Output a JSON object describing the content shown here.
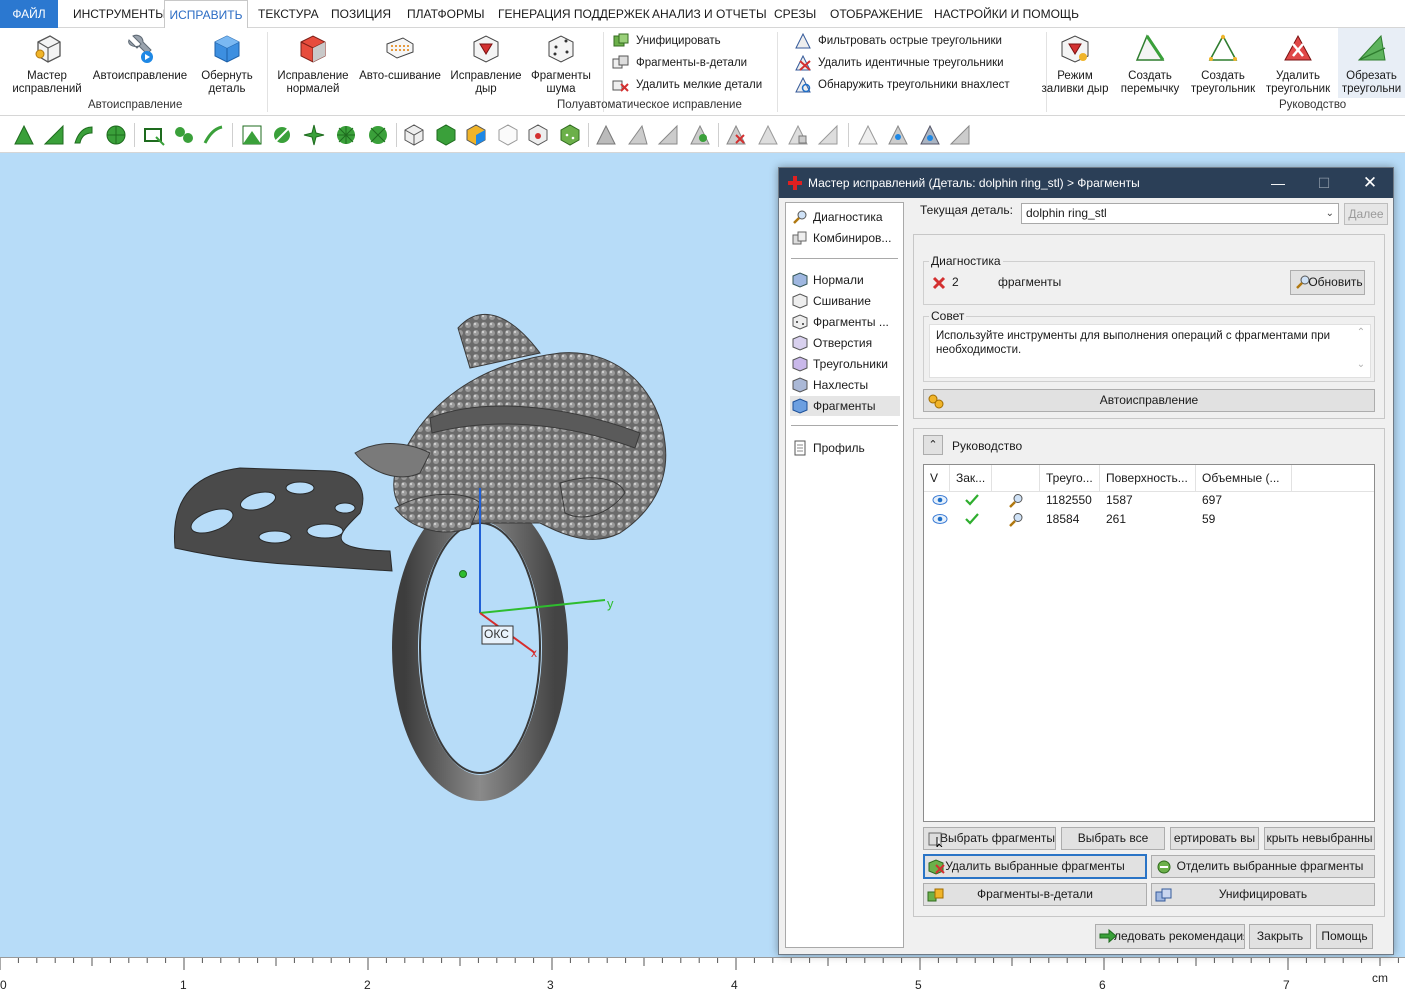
{
  "menu": {
    "file": "ФАЙЛ",
    "tools": "ИНСТРУМЕНТЫ",
    "fix": "ИСПРАВИТЬ",
    "texture": "ТЕКСТУРА",
    "position": "ПОЗИЦИЯ",
    "platforms": "ПЛАТФОРМЫ",
    "supports": "ГЕНЕРАЦИЯ ПОДДЕРЖЕК",
    "analysis": "АНАЛИЗ И ОТЧЕТЫ",
    "slices": "СРЕЗЫ",
    "display": "ОТОБРАЖЕНИЕ",
    "settings": "НАСТРОЙКИ И ПОМОЩЬ"
  },
  "ribbon": {
    "wizard": [
      "Мастер",
      "исправлений"
    ],
    "autofix": [
      "Автоисправление"
    ],
    "wrap": [
      "Обернуть",
      "деталь"
    ],
    "group_auto": "Автоисправление",
    "fix_normals": [
      "Исправление",
      "нормалей"
    ],
    "auto_stitch": [
      "Авто-сшивание"
    ],
    "fix_holes": [
      "Исправление",
      "дыр"
    ],
    "noise_shells": [
      "Фрагменты",
      "шума"
    ],
    "unify": "Унифицировать",
    "shells_to_parts": "Фрагменты-в-детали",
    "remove_small": "Удалить мелкие детали",
    "filter_sharp": "Фильтровать острые треугольники",
    "remove_identical": "Удалить идентичные треугольники",
    "detect_overlap": "Обнаружить треугольники внахлест",
    "group_semi": "Полуавтоматическое исправление",
    "hole_fill_mode": [
      "Режим",
      "заливки дыр"
    ],
    "create_bridge": [
      "Создать",
      "перемычку"
    ],
    "create_triangle": [
      "Создать",
      "треугольник"
    ],
    "delete_triangle": [
      "Удалить",
      "треугольник"
    ],
    "trim_triangle": [
      "Обрезать",
      "треугольни"
    ],
    "group_manual": "Руководство"
  },
  "viewport": {
    "axis_y": "y",
    "axis_x": "x",
    "origin_label": "ОКС"
  },
  "ruler": {
    "ticks": [
      "0",
      "1",
      "2",
      "3",
      "4",
      "5",
      "6",
      "7"
    ],
    "unit": "cm"
  },
  "dialog": {
    "title": "Мастер исправлений (Деталь: dolphin ring_stl) > Фрагменты",
    "nav": [
      "Диагностика",
      "Комбиниров...",
      "Нормали",
      "Сшивание",
      "Фрагменты ...",
      "Отверстия",
      "Треугольники",
      "Нахлесты",
      "Фрагменты",
      "Профиль"
    ],
    "current_part_label": "Текущая деталь:",
    "current_part_value": "dolphin ring_stl",
    "next_button": "Далее",
    "diag_group": "Диагностика",
    "diag_count": "2",
    "diag_text": "фрагменты",
    "refresh_button": "Обновить",
    "tip_group": "Совет",
    "tip_text": "Используйте инструменты для выполнения операций с фрагментами при необходимости.",
    "autofix_button": "Автоисправление",
    "manual_title": "Руководство",
    "columns": [
      "V",
      "Зак...",
      "",
      "Треуго...",
      "Поверхность...",
      "Объемные (..."
    ],
    "rows": [
      {
        "triangles": "1182550",
        "surfaces": "1587",
        "volumes": "697"
      },
      {
        "triangles": "18584",
        "surfaces": "261",
        "volumes": "59"
      }
    ],
    "btn_select_shells": "Выбрать фрагменты",
    "btn_select_all": "Выбрать все",
    "btn_invert": "ертировать вы",
    "btn_hide_unselected": "крыть невыбранны",
    "btn_delete_selected": "Удалить выбранные фрагменты",
    "btn_separate_selected": "Отделить выбранные фрагменты",
    "btn_shells_to_parts": "Фрагменты-в-детали",
    "btn_unify": "Унифицировать",
    "btn_follow": "ледовать рекомендациям",
    "btn_close": "Закрыть",
    "btn_help": "Помощь"
  },
  "colors": {
    "accent": "#2b78d0",
    "titlebar": "#2b3f57",
    "viewport_bg": "#b7dcf8",
    "error_red": "#d33030",
    "ok_green": "#2fae2f"
  }
}
